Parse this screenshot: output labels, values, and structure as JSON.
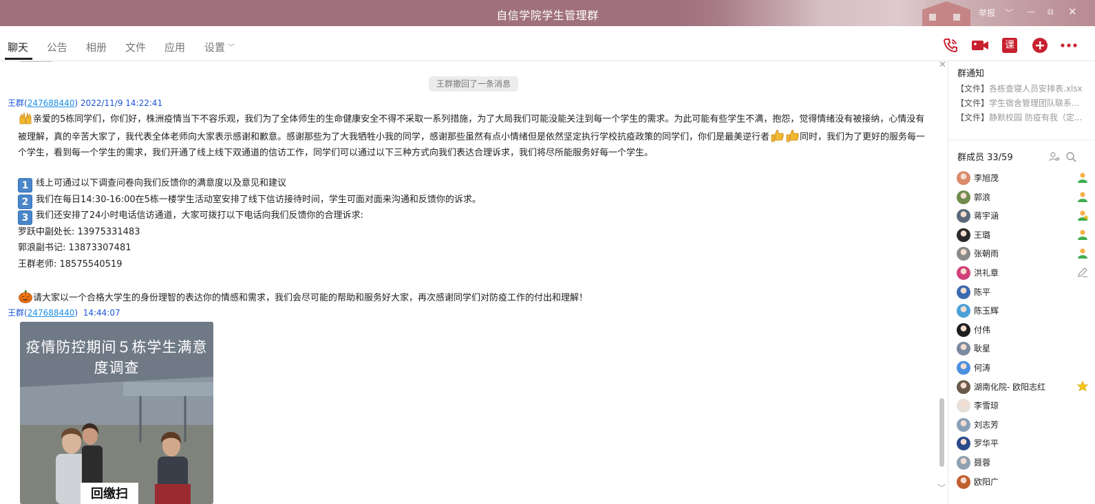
{
  "window": {
    "title": "自信学院学生管理群",
    "controls": [
      "举报",
      "﹀",
      "—",
      "⧉",
      "✕"
    ]
  },
  "tabs": [
    {
      "label": "聊天",
      "active": true
    },
    {
      "label": "公告"
    },
    {
      "label": "相册"
    },
    {
      "label": "文件"
    },
    {
      "label": "应用"
    },
    {
      "label": "设置"
    }
  ],
  "toolbar": {
    "icons": [
      "phone-icon",
      "video-icon",
      "class-icon",
      "add-app-icon",
      "more-icon"
    ],
    "class_label": "课",
    "accent": "#c8202f"
  },
  "chat": {
    "recall_notice": "王群撤回了一条消息",
    "message1": {
      "sender_name": "王群(",
      "sender_id": "247688440",
      "sender_tail": ")",
      "time": "2022/11/9 14:22:41",
      "para_a": "亲爱的5栋同学们，你们好，株洲疫情当下不容乐观，我们为了全体师生的生命健康安全不得不采取一系列措施，为了大局我们可能没能关注到每一个学生的需求。为此可能有些学生不满，抱怨，觉得情绪没有被接纳，心情没有被理解，真的辛苦大家了，我代表全体老师向大家表示感谢和歉意。感谢那些为了大我牺牲小我的同学，感谢那些虽然有点小情绪但是依然坚定执行学校抗疫政策的同学们，你们是最美逆行者",
      "para_b": "同时，我们为了更好的服务每一个学生，看到每一个学生的需求，我们开通了线上线下双通道的信访工作，同学们可以通过以下三种方式向我们表达合理诉求，我们将尽所能服务好每一个学生。",
      "items": [
        {
          "num": "1",
          "text": "线上可通过以下调查问卷向我们反馈你的满意度以及意见和建议"
        },
        {
          "num": "2",
          "text": "我们在每日14:30-16:00在5栋一楼学生活动室安排了线下信访接待时间，学生可面对面来沟通和反馈你的诉求。"
        },
        {
          "num": "3",
          "text": "我们还安排了24小时电话信访通道，大家可拨打以下电话向我们反馈你的合理诉求:"
        }
      ],
      "contacts": [
        "罗跃中副处长: 13975331483",
        "郭浪副书记: 13873307481",
        "王群老师: 18575540519"
      ],
      "closing": "请大家以一个合格大学生的身份理智的表达你的情感和需求，我们会尽可能的帮助和服务好大家，再次感谢同学们对防疫工作的付出和理解！"
    },
    "message2": {
      "sender_name": "王群(",
      "sender_id": "247688440",
      "sender_tail": ")",
      "time": "14:44:07",
      "poster_title": "疫情防控期间５栋学生满意度调查",
      "poster_bottom_text": "回缴扫"
    }
  },
  "side": {
    "notice_title": "群通知",
    "notices": [
      {
        "tag": "【文件】",
        "text": "各栋查寝人员安排表.xlsx"
      },
      {
        "tag": "【文件】",
        "text": "学生宿舍管理团队联系..."
      },
      {
        "tag": "【文件】",
        "text": "静默校园 防疫有我（定..."
      }
    ],
    "members_title": "群成员 33/59",
    "members": [
      {
        "name": "李旭茂",
        "avatar": "#d98a6a",
        "badge": "admin"
      },
      {
        "name": "郭浪",
        "avatar": "#6f8c4e",
        "badge": "admin"
      },
      {
        "name": "蒋宇涵",
        "avatar": "#5a6a7a",
        "badge": "admin-star"
      },
      {
        "name": "王璐",
        "avatar": "#2a2a2a",
        "badge": "admin"
      },
      {
        "name": "张朝雨",
        "avatar": "#8a8a8a",
        "badge": "admin"
      },
      {
        "name": "洪礼章",
        "avatar": "#d0407a",
        "badge": "edit"
      },
      {
        "name": "陈平",
        "avatar": "#3a6ab0",
        "badge": ""
      },
      {
        "name": "陈玉辉",
        "avatar": "#4aa0d8",
        "badge": ""
      },
      {
        "name": "付伟",
        "avatar": "#1e1e1e",
        "badge": ""
      },
      {
        "name": "耿星",
        "avatar": "#7a8aa0",
        "badge": ""
      },
      {
        "name": "何涛",
        "avatar": "#4a90e0",
        "badge": ""
      },
      {
        "name": "湖南化院- 欧阳志红",
        "avatar": "#6a5a4a",
        "badge": "star"
      },
      {
        "name": "李雪琼",
        "avatar": "#e8e0d8",
        "badge": ""
      },
      {
        "name": "刘志芳",
        "avatar": "#8aa0b8",
        "badge": ""
      },
      {
        "name": "罗华平",
        "avatar": "#2a4a8a",
        "badge": ""
      },
      {
        "name": "聂蓉",
        "avatar": "#90a0b0",
        "badge": ""
      },
      {
        "name": "欧阳广",
        "avatar": "#c06030",
        "badge": ""
      }
    ]
  }
}
